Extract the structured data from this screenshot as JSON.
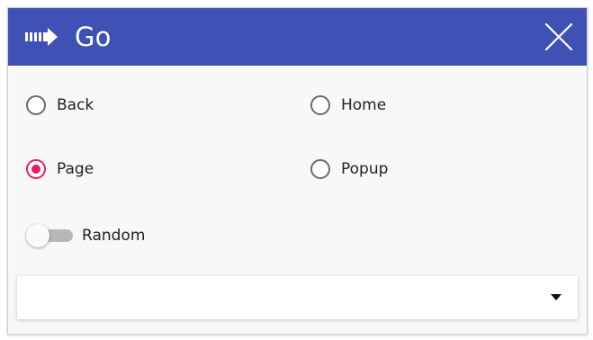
{
  "header": {
    "title": "Go",
    "icon": "go-arrow-icon",
    "close_icon": "close-icon",
    "background_color": "#3f51b5"
  },
  "options": {
    "items": [
      {
        "label": "Back",
        "checked": false
      },
      {
        "label": "Home",
        "checked": false
      },
      {
        "label": "Page",
        "checked": true
      },
      {
        "label": "Popup",
        "checked": false
      }
    ],
    "accent_color": "#e91e63"
  },
  "random_toggle": {
    "label": "Random",
    "on": false
  },
  "select": {
    "value": "",
    "icon": "chevron-down-icon"
  }
}
